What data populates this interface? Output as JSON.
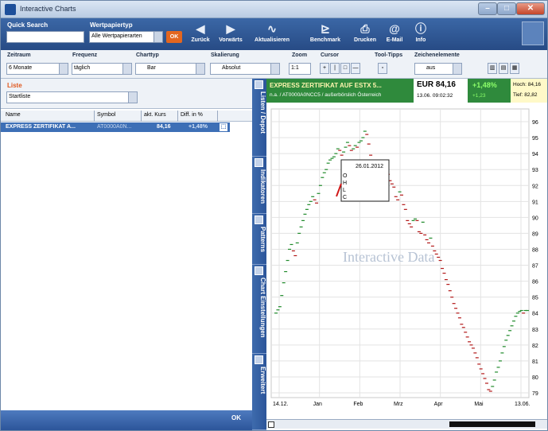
{
  "window": {
    "title": "Interactive Charts"
  },
  "toolbar": {
    "quick_search_label": "Quick Search",
    "wertpapiertyp_label": "Wertpapiertyp",
    "wertpapiertyp_value": "Alle Wertpapierarten",
    "ok_label": "OK",
    "buttons": [
      {
        "label": "Zurück",
        "icon": "arrow-left-icon"
      },
      {
        "label": "Vorwärts",
        "icon": "arrow-right-icon"
      },
      {
        "label": "Aktualisieren",
        "icon": "refresh-icon"
      },
      {
        "label": "Benchmark",
        "icon": "benchmark-icon"
      },
      {
        "label": "Drucken",
        "icon": "print-icon"
      },
      {
        "label": "E-Mail",
        "icon": "email-icon"
      },
      {
        "label": "Info",
        "icon": "info-icon"
      }
    ]
  },
  "options": {
    "zeitraum_label": "Zeitraum",
    "zeitraum_value": "6 Monate",
    "frequenz_label": "Frequenz",
    "frequenz_value": "täglich",
    "charttyp_label": "Charttyp",
    "charttyp_value": "Bar",
    "skalierung_label": "Skalierung",
    "skalierung_value": "Absolut",
    "zoom_label": "Zoom",
    "zoom_value": "1:1",
    "cursor_label": "Cursor",
    "tooltips_label": "Tool-Tipps",
    "zeichen_label": "Zeichenelemente",
    "zeichen_value": "aus"
  },
  "liste": {
    "label": "Liste",
    "value": "Startliste",
    "columns": [
      "Name",
      "Symbol",
      "akt. Kurs",
      "Diff. in %"
    ],
    "rows": [
      {
        "name": "EXPRESS ZERTIFIKAT A...",
        "symbol": "AT0000A0N...",
        "kurs": "84,16",
        "diff": "+1,48%"
      }
    ],
    "ok_label": "OK"
  },
  "sidetabs": [
    "Listen / Depot",
    "Indikatoren",
    "Patterns",
    "Chart Einstellungen",
    "Erweitert"
  ],
  "quote": {
    "name": "EXPRESS ZERTIFIKAT AUF ESTX 5...",
    "isin_line": "n.a. / AT0000A0NCC5 / außerbörslich Österreich",
    "price": "EUR 84,16",
    "time": "13.06. 09:02:32",
    "change_pct": "+1,48%",
    "change_abs": "+1,23",
    "high": "Hoch: 84,16",
    "low": "Tief: 82,82"
  },
  "chart_data": {
    "type": "bar",
    "watermark": "Interactive Data",
    "x_ticks": [
      "14.12.",
      "Jan",
      "Feb",
      "Mrz",
      "Apr",
      "Mai",
      "13.06."
    ],
    "y_ticks": [
      79,
      80,
      81,
      82,
      83,
      84,
      85,
      86,
      87,
      88,
      89,
      90,
      91,
      92,
      93,
      94,
      95,
      96
    ],
    "ylim": [
      79,
      96.5
    ],
    "tooltip": {
      "date": "26.01.2012",
      "labels": [
        "O",
        "H",
        "L",
        "C"
      ]
    },
    "x_index_range": [
      0,
      130
    ],
    "series": [
      {
        "values": [
          84.0,
          84.2,
          84.4,
          85.1,
          85.9,
          86.6,
          87.3,
          88.0,
          88.3,
          87.9,
          87.6,
          88.4,
          89.0,
          89.4,
          89.8,
          90.2,
          90.5,
          90.8,
          91.0,
          91.3,
          91.1,
          90.9,
          91.5,
          92.0,
          92.5,
          92.8,
          93.0,
          93.4,
          93.6,
          93.7,
          93.8,
          94.0,
          94.3,
          94.2,
          93.9,
          94.1,
          94.4,
          94.7,
          94.5,
          94.2,
          94.3,
          94.5,
          94.4,
          94.7,
          94.8,
          95.0,
          95.4,
          95.2,
          94.6,
          93.9,
          93.4,
          93.0,
          93.2,
          93.6,
          93.2,
          93.5,
          93.1,
          92.8,
          92.7,
          92.3,
          92.1,
          91.9,
          91.3,
          91.1,
          91.6,
          91.4,
          90.8,
          90.5,
          89.8,
          89.6,
          89.4,
          89.8,
          89.9,
          89.8,
          89.1,
          89.0,
          89.7,
          88.9,
          88.6,
          88.4,
          88.7,
          88.2,
          87.9,
          87.7,
          87.5,
          87.3,
          86.8,
          86.5,
          86.1,
          85.8,
          85.4,
          85.0,
          84.6,
          84.3,
          84.0,
          83.7,
          83.3,
          83.1,
          82.8,
          82.5,
          82.2,
          82.0,
          81.8,
          81.5,
          81.2,
          80.8,
          80.5,
          80.2,
          79.9,
          79.6,
          79.2,
          79.1,
          79.4,
          79.8,
          80.3,
          80.6,
          81.0,
          81.5,
          81.9,
          82.3,
          82.6,
          82.9,
          83.2,
          83.5,
          83.8,
          84.0,
          84.1,
          84.16,
          84.0,
          84.16,
          84.16
        ]
      }
    ]
  }
}
